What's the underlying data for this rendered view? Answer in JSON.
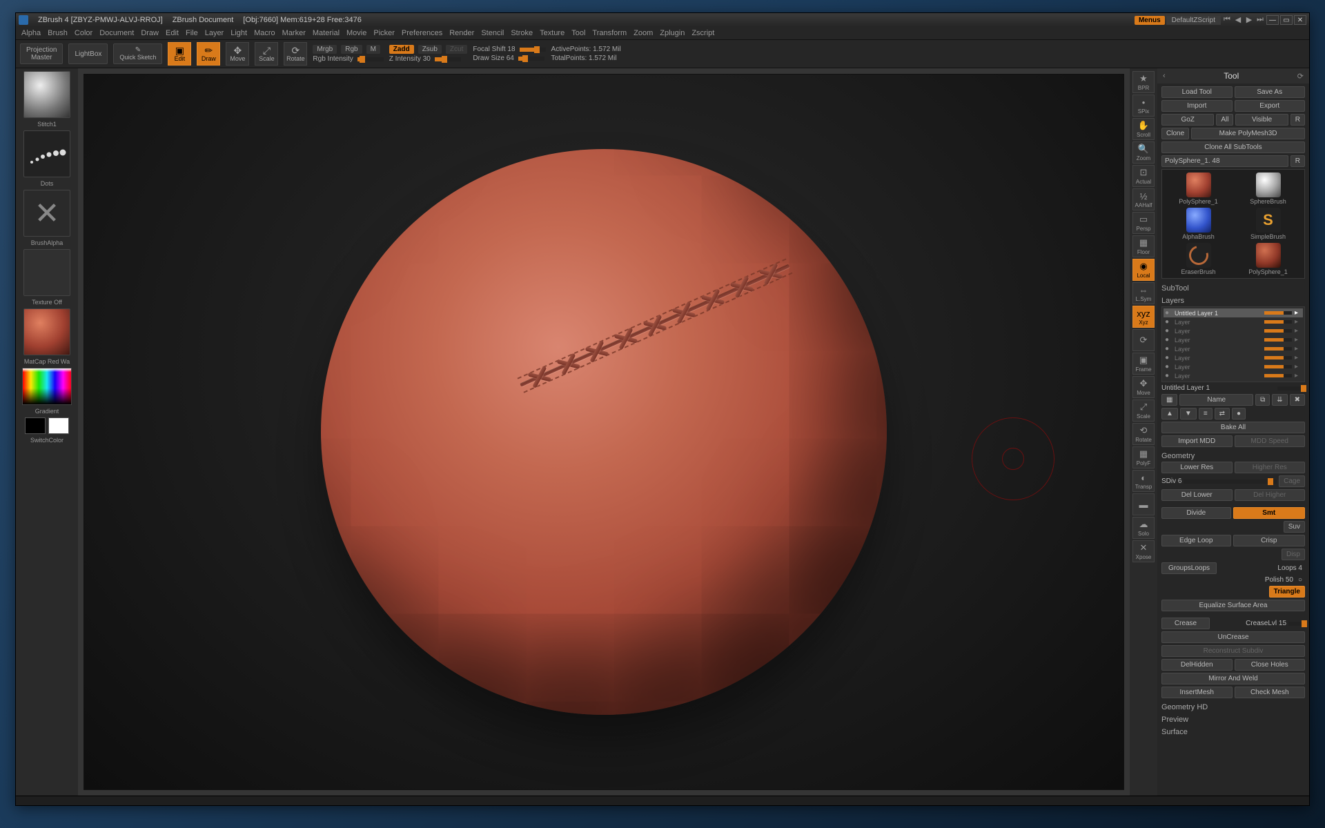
{
  "title": {
    "app": "ZBrush 4 [ZBYZ-PMWJ-ALVJ-RROJ]",
    "doc": "ZBrush Document",
    "stats": "[Obj:7660]  Mem:619+28  Free:3476",
    "menus": "Menus",
    "script": "DefaultZScript"
  },
  "menu": [
    "Alpha",
    "Brush",
    "Color",
    "Document",
    "Draw",
    "Edit",
    "File",
    "Layer",
    "Light",
    "Macro",
    "Marker",
    "Material",
    "Movie",
    "Picker",
    "Preferences",
    "Render",
    "Stencil",
    "Stroke",
    "Texture",
    "Tool",
    "Transform",
    "Zoom",
    "Zplugin",
    "Zscript"
  ],
  "shelf": {
    "projection1": "Projection",
    "projection2": "Master",
    "lightbox": "LightBox",
    "quicksketch": "Quick Sketch",
    "edit": "Edit",
    "draw": "Draw",
    "move": "Move",
    "scale": "Scale",
    "rotate": "Rotate",
    "mrgb": "Mrgb",
    "rgb": "Rgb",
    "m": "M",
    "rgbintensity": "Rgb Intensity",
    "zadd": "Zadd",
    "zsub": "Zsub",
    "zcut": "Zcut",
    "zintensity_lbl": "Z Intensity 30",
    "focal_lbl": "Focal Shift 18",
    "drawsize_lbl": "Draw Size 64",
    "activepoints": "ActivePoints: 1.572 Mil",
    "totalpoints": "TotalPoints: 1.572 Mil"
  },
  "left": {
    "brush": "Stitch1",
    "stroke": "Dots",
    "alpha": "BrushAlpha",
    "texture": "Texture Off",
    "material": "MatCap Red Wa",
    "gradient": "Gradient",
    "switch": "SwitchColor"
  },
  "nav": [
    "BPR",
    "SPix",
    "Scroll",
    "Zoom",
    "Actual",
    "AAHalf",
    "Persp",
    "Floor",
    "Local",
    "L.Sym",
    "Xyz",
    "",
    "Frame",
    "Move",
    "Scale",
    "Rotate",
    "PolyF",
    "Transp",
    "",
    "Solo",
    "Xpose"
  ],
  "nav_active": [
    8,
    10
  ],
  "right": {
    "title": "Tool",
    "row1": [
      "Load Tool",
      "Save As"
    ],
    "row2": [
      "Import",
      "Export"
    ],
    "row3": [
      "GoZ",
      "All",
      "Visible",
      "R"
    ],
    "row4": [
      "Clone",
      "Make PolyMesh3D"
    ],
    "row5": "Clone All SubTools",
    "activemesh": "PolySphere_1. 48",
    "tools": [
      {
        "label": "PolySphere_1",
        "ico": "ball"
      },
      {
        "label": "SphereBrush",
        "ico": "metal"
      },
      {
        "label": "AlphaBrush",
        "ico": "blue"
      },
      {
        "label": "SimpleBrush",
        "ico": "s"
      },
      {
        "label": "EraserBrush",
        "ico": "ring"
      },
      {
        "label": "PolySphere_1",
        "ico": "ball2"
      }
    ],
    "subtool": "SubTool",
    "layers": "Layers",
    "layer_names": [
      "Untitled Layer 1",
      "Layer",
      "Layer",
      "Layer",
      "Layer",
      "Layer",
      "Layer",
      "Layer"
    ],
    "untitled": "Untitled Layer 1",
    "name_btn": "Name",
    "bakeall": "Bake All",
    "importmdd": "Import MDD",
    "mddspeed": "MDD Speed",
    "geometry": "Geometry",
    "lowerres": "Lower Res",
    "higherres": "Higher Res",
    "sdiv": "SDiv 6",
    "cage": "Cage",
    "dellower": "Del Lower",
    "delhigher": "Del Higher",
    "divide": "Divide",
    "smt": "Smt",
    "suv": "Suv",
    "edgeloop": "Edge Loop",
    "crisp": "Crisp",
    "disp": "Disp",
    "groupsloops": "GroupsLoops",
    "loops": "Loops 4",
    "polish": "Polish 50",
    "triangle": "Triangle",
    "equalize": "Equalize Surface Area",
    "crease": "Crease",
    "creaselvl": "CreaseLvl 15",
    "uncrease": "UnCrease",
    "reconstruct": "Reconstruct Subdiv",
    "delhidden": "DelHidden",
    "closeholes": "Close Holes",
    "mirrorweld": "Mirror And Weld",
    "insertmesh": "InsertMesh",
    "checkmesh": "Check Mesh",
    "geometryhd": "Geometry HD",
    "preview": "Preview",
    "surface": "Surface"
  }
}
